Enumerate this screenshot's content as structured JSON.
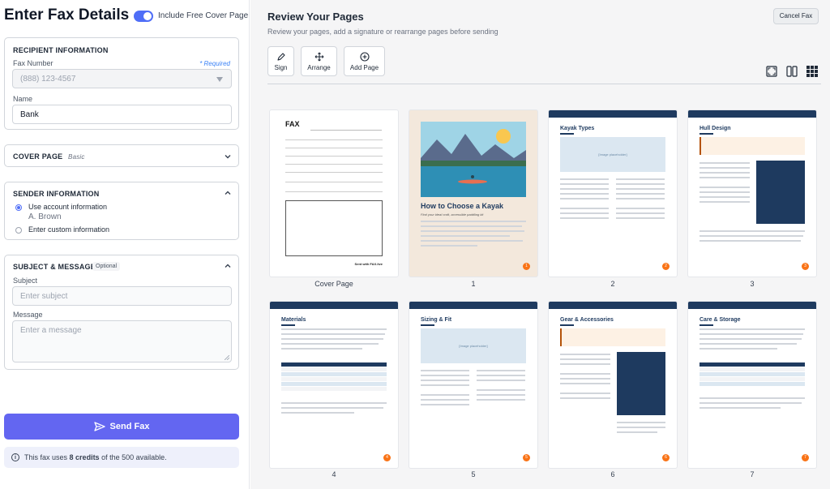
{
  "left": {
    "title": "Enter Fax Details",
    "cover_toggle_label": "Include Free Cover Page",
    "recipient": {
      "title": "RECIPIENT INFORMATION",
      "fax_label": "Fax Number",
      "required_label": "* Required",
      "fax_placeholder": "(888) 123-4567",
      "name_label": "Name",
      "name_value": "Bank"
    },
    "cover_page": {
      "title": "COVER PAGE",
      "value": "Basic"
    },
    "sender": {
      "title": "SENDER INFORMATION",
      "option_account": "Use account information",
      "account_name": "A. Brown",
      "option_custom": "Enter custom information"
    },
    "subject": {
      "title": "SUBJECT & MESSAGE",
      "badge": "Optional",
      "subject_label": "Subject",
      "subject_placeholder": "Enter subject",
      "message_label": "Message",
      "message_placeholder": "Enter a message"
    },
    "send_label": "Send Fax",
    "info": {
      "prefix": "This fax uses",
      "credits": "8 credits",
      "suffix": "of the 500 available."
    }
  },
  "right": {
    "title": "Review Your Pages",
    "subtitle": "Review your pages, add a signature or rearrange pages before sending",
    "cancel_label": "Cancel Fax",
    "tools": [
      {
        "label": "Sign",
        "icon": "pen-icon"
      },
      {
        "label": "Arrange",
        "icon": "move-icon"
      },
      {
        "label": "Add Page",
        "icon": "plus-circle-icon"
      }
    ],
    "view_icons": [
      "fullscreen-icon",
      "two-column-icon",
      "grid-icon"
    ],
    "pages": [
      {
        "label": "Cover Page",
        "kind": "cover"
      },
      {
        "label": "1",
        "kind": "kayak-title"
      },
      {
        "label": "2",
        "kind": "kayak-types"
      },
      {
        "label": "3",
        "kind": "hull-design"
      },
      {
        "label": "4",
        "kind": "materials"
      },
      {
        "label": "5",
        "kind": "sizing"
      },
      {
        "label": "6",
        "kind": "gear"
      },
      {
        "label": "7",
        "kind": "care"
      }
    ],
    "thumb_text": {
      "fax_heading": "FAX",
      "fax_footer": "Sent with FAX.live",
      "cover_title": "How to Choose a Kayak",
      "cover_subtitle": "Find your ideal craft, accessible paddling kit",
      "types_heading": "Kayak Types",
      "hull_heading": "Hull Design",
      "materials_heading": "Materials",
      "sizing_heading": "Sizing & Fit",
      "gear_heading": "Gear & Accessories",
      "care_heading": "Care & Storage",
      "image_placeholder": "[Image placeholder]"
    }
  }
}
